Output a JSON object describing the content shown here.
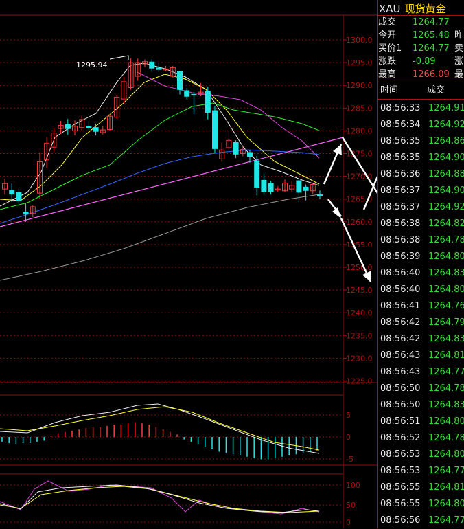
{
  "chart": {
    "price_ticks": [
      "1300.0",
      "1295.0",
      "1290.0",
      "1285.0",
      "1280.0",
      "1275.0",
      "1270.0",
      "1265.0",
      "1260.0",
      "1255.0",
      "1250.0",
      "1245.0",
      "1240.0",
      "1235.0",
      "1230.0",
      "1225.0"
    ],
    "high_label": "1295.94",
    "macd_ticks": [
      "5",
      "0",
      "-5"
    ],
    "kdj_ticks": [
      "100",
      "50",
      "0"
    ],
    "colors": {
      "bull": "#ff3b3b",
      "bear": "#22e6e6",
      "grid": "#8b1010",
      "axis_text": "#b01010",
      "annotation": "#ffffff"
    }
  },
  "quote": {
    "symbol": "XAU",
    "name": "现货黄金",
    "rows": [
      {
        "label": "成交",
        "value": "1264.77",
        "extra": "",
        "color": "green"
      },
      {
        "label": "今开",
        "value": "1265.48",
        "extra": "昨",
        "color": "green"
      },
      {
        "label": "买价1",
        "value": "1264.77",
        "extra": "卖",
        "color": "green"
      },
      {
        "label": "涨跌",
        "value": "-0.89",
        "extra": "涨",
        "color": "green"
      },
      {
        "label": "最高",
        "value": "1266.09",
        "extra": "最",
        "color": "red"
      }
    ]
  },
  "ticks": {
    "header_time": "时间",
    "header_price": "成交",
    "rows": [
      {
        "time": "08:56:33",
        "price": "1264.91"
      },
      {
        "time": "08:56:34",
        "price": "1264.92"
      },
      {
        "time": "08:56:35",
        "price": "1264.86"
      },
      {
        "time": "08:56:35",
        "price": "1264.90"
      },
      {
        "time": "08:56:36",
        "price": "1264.88"
      },
      {
        "time": "08:56:37",
        "price": "1264.90"
      },
      {
        "time": "08:56:37",
        "price": "1264.92"
      },
      {
        "time": "08:56:38",
        "price": "1264.82"
      },
      {
        "time": "08:56:38",
        "price": "1264.78"
      },
      {
        "time": "08:56:39",
        "price": "1264.80"
      },
      {
        "time": "08:56:40",
        "price": "1264.83"
      },
      {
        "time": "08:56:40",
        "price": "1264.80"
      },
      {
        "time": "08:56:41",
        "price": "1264.76"
      },
      {
        "time": "08:56:42",
        "price": "1264.79"
      },
      {
        "time": "08:56:42",
        "price": "1264.83"
      },
      {
        "time": "08:56:43",
        "price": "1264.81"
      },
      {
        "time": "08:56:43",
        "price": "1264.77"
      },
      {
        "time": "08:56:50",
        "price": "1264.78"
      },
      {
        "time": "08:56:50",
        "price": "1264.83"
      },
      {
        "time": "08:56:51",
        "price": "1264.80"
      },
      {
        "time": "08:56:52",
        "price": "1264.78"
      },
      {
        "time": "08:56:53",
        "price": "1264.80"
      },
      {
        "time": "08:56:53",
        "price": "1264.77"
      },
      {
        "time": "08:56:55",
        "price": "1264.81"
      },
      {
        "time": "08:56:55",
        "price": "1264.80"
      },
      {
        "time": "08:56:56",
        "price": "1264.77"
      }
    ]
  }
}
